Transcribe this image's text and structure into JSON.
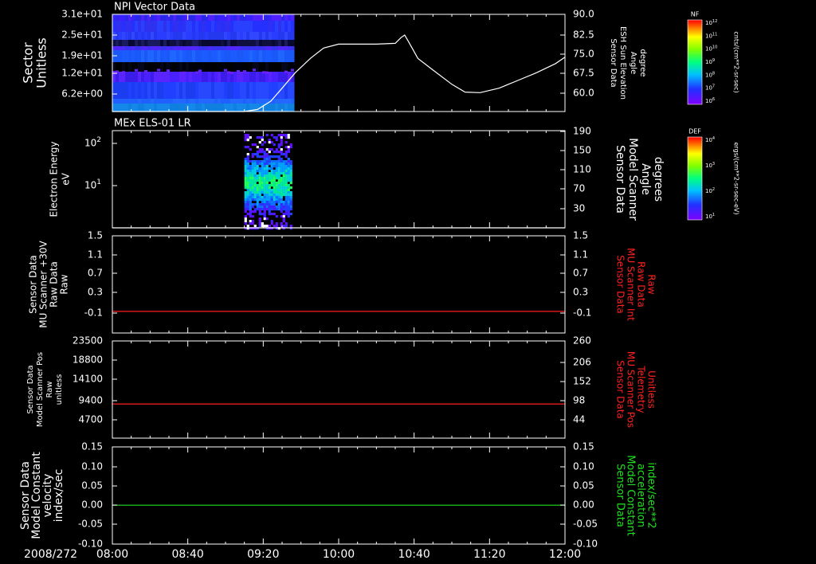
{
  "date_label": "2008/272",
  "x_ticks": [
    "08:00",
    "08:40",
    "09:20",
    "10:00",
    "10:40",
    "11:20",
    "12:00"
  ],
  "chart_data": [
    {
      "type": "heatmap",
      "title": "NPI Vector Data",
      "ylabel": [
        "Sector",
        "Unitless"
      ],
      "yticks": [
        "3.1e+01",
        "2.5e+01",
        "1.9e+01",
        "1.2e+01",
        "6.2e+00"
      ],
      "y2label": [
        "Sensor Data",
        "ESH Sun Elevation",
        "Angle",
        "degree"
      ],
      "y2ticks": [
        "90.0",
        "82.5",
        "75.0",
        "67.5",
        "60.0"
      ],
      "y2lim": [
        52.5,
        90.0
      ],
      "y2_color": "#ffffff",
      "heatmap_time_range": [
        "08:00",
        "09:35"
      ],
      "colorbar": {
        "tag": "NF",
        "label": "cnts/(cm**2-sr-sec)",
        "ticks": [
          "10^12",
          "10^11",
          "10^10",
          "10^9",
          "10^8",
          "10^7",
          "10^6"
        ]
      },
      "line_series": {
        "name": "ESH Sun Elevation Angle",
        "x": [
          "08:00",
          "09:10",
          "09:17",
          "09:24",
          "09:30",
          "09:37",
          "09:45",
          "09:52",
          "10:00",
          "10:10",
          "10:20",
          "10:30",
          "10:33",
          "10:35",
          "10:37",
          "10:42",
          "10:50",
          "11:00",
          "11:07",
          "11:15",
          "11:25",
          "11:35",
          "11:45",
          "11:55",
          "12:00"
        ],
        "y": [
          52.5,
          52.5,
          53.3,
          56.5,
          61.5,
          67.5,
          73.0,
          77.0,
          78.5,
          78.5,
          78.5,
          78.8,
          81.0,
          82.0,
          79.5,
          73.0,
          68.5,
          63.0,
          60.0,
          59.8,
          61.5,
          64.5,
          67.5,
          71.0,
          73.5
        ]
      }
    },
    {
      "type": "heatmap",
      "title": "MEx ELS-01 LR",
      "ylabel": [
        "Electron Energy",
        "eV"
      ],
      "yticks": [
        "10^2",
        "10^1"
      ],
      "y2label": [
        "Sensor Data",
        "Model Scanner",
        "Angle",
        "degrees"
      ],
      "y2ticks": [
        "190",
        "150",
        "110",
        "70",
        "30"
      ],
      "y2lim": [
        10,
        190
      ],
      "y2_color": "#ffffff",
      "heatmap_time_range": [
        "09:10",
        "09:35"
      ],
      "colorbar": {
        "tag": "DEF",
        "label": "ergs/(cm**2-sr-sec-eV)",
        "ticks": [
          "10^4",
          "10^3",
          "10^2",
          "10^1"
        ]
      },
      "line_series": {
        "name": "Model Scanner Angle",
        "x": [
          "08:00",
          "12:00"
        ],
        "y": [
          10,
          10
        ]
      }
    },
    {
      "type": "line",
      "ylabel": [
        "Sensor Data",
        "MU Scanner +30V",
        "Raw Data",
        "Raw"
      ],
      "yticks": [
        "1.5",
        "1.1",
        "0.7",
        "0.3",
        "-0.1"
      ],
      "ylim": [
        -0.3,
        1.5
      ],
      "y2label": [
        "Sensor Data",
        "MU Scanner Int",
        "Raw Data",
        "Raw"
      ],
      "y2ticks": [
        "1.5",
        "1.1",
        "0.7",
        "0.3",
        "-0.1"
      ],
      "y2_color": "#ff2020",
      "series": [
        {
          "name": "MU Scanner Int Raw Data",
          "color": "#ff2020",
          "x": [
            "08:00",
            "12:00"
          ],
          "y": [
            0.1,
            0.1
          ]
        }
      ]
    },
    {
      "type": "line",
      "ylabel": [
        "Sensor Data",
        "Model Scanner Pos",
        "Raw",
        "unitless"
      ],
      "yticks": [
        "23500",
        "18800",
        "14100",
        "9400",
        "4700"
      ],
      "ylim": [
        0,
        23500
      ],
      "y2label": [
        "Sensor Data",
        "MU Scanner Pos",
        "Telemetry",
        "Unitless"
      ],
      "y2ticks": [
        "260",
        "206",
        "152",
        "98",
        "44"
      ],
      "y2lim": [
        -10,
        260
      ],
      "y2_color": "#ff2020",
      "series": [
        {
          "name": "MU Scanner Pos Telemetry",
          "color": "#ff2020",
          "x": [
            "08:00",
            "12:00"
          ],
          "y": [
            85,
            85
          ]
        }
      ]
    },
    {
      "type": "line",
      "ylabel": [
        "Sensor Data",
        "Model Constant",
        "velocity",
        "index/sec"
      ],
      "yticks": [
        "0.15",
        "0.10",
        "0.05",
        "0.00",
        "-0.05",
        "-0.10"
      ],
      "ylim": [
        -0.1,
        0.15
      ],
      "y2label": [
        "Sensor Data",
        "Model Constant",
        "acceleration",
        "index/sec**2"
      ],
      "y2ticks": [
        "0.15",
        "0.10",
        "0.05",
        "0.00",
        "-0.05",
        "-0.10"
      ],
      "y2_color": "#20e020",
      "series": [
        {
          "name": "Model Constant acceleration",
          "color": "#20e020",
          "x": [
            "08:00",
            "12:00"
          ],
          "y": [
            0.0,
            0.0
          ]
        }
      ]
    }
  ]
}
